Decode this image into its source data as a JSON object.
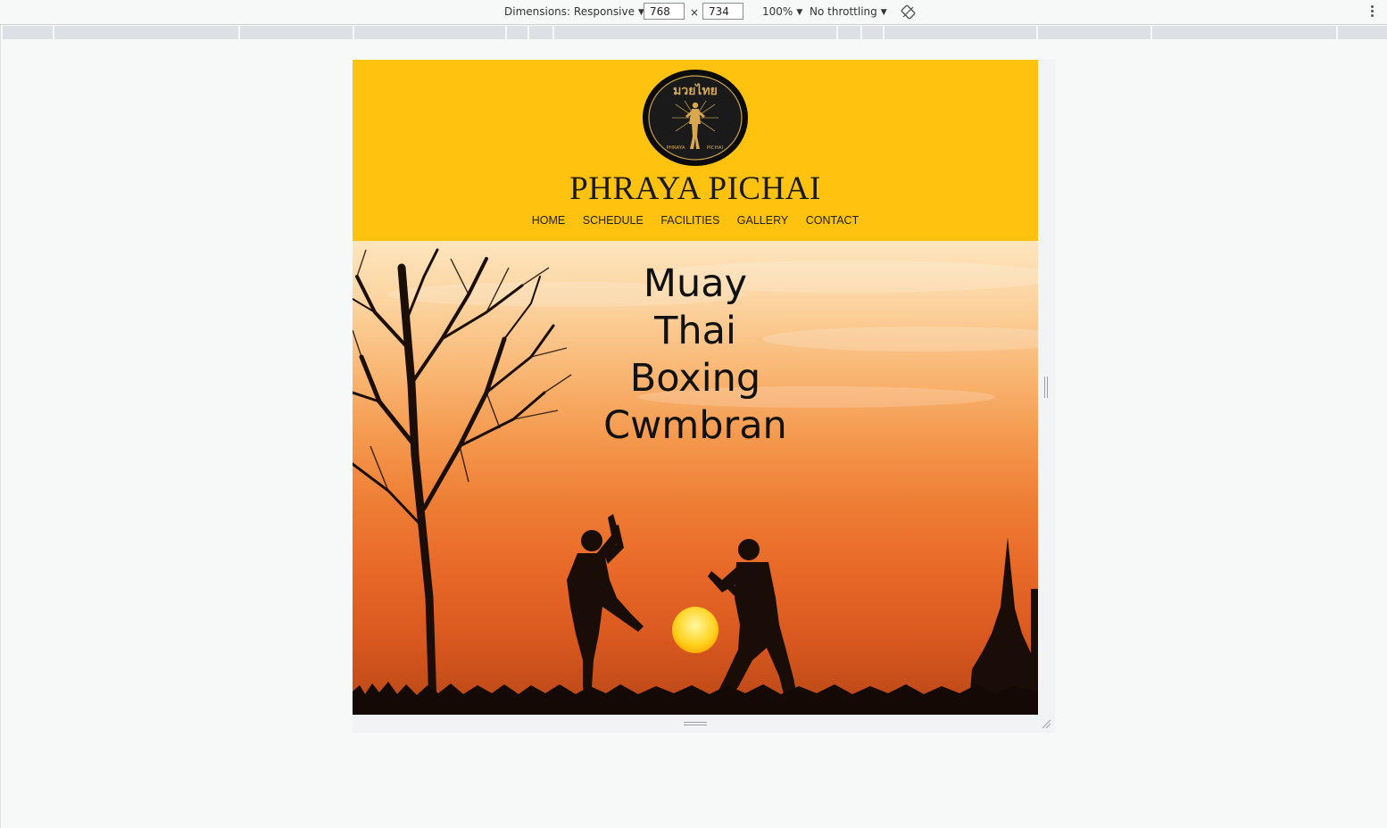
{
  "devtools": {
    "dimensions_label": "Dimensions: Responsive",
    "width_value": "768",
    "times_sign": "×",
    "height_value": "734",
    "zoom_label": "100%",
    "throttling_label": "No throttling",
    "caret": "▼"
  },
  "site": {
    "logo": {
      "thai_text": "มวยไทย",
      "left_text": "PHRAYA",
      "right_text": "PICHAI"
    },
    "title": "PHRAYA PICHAI",
    "nav": [
      "HOME",
      "SCHEDULE",
      "FACILITIES",
      "GALLERY",
      "CONTACT"
    ],
    "hero_lines": [
      "Muay",
      "Thai",
      "Boxing",
      "Cwmbran"
    ]
  },
  "colors": {
    "header_bg": "#ffc20e",
    "hero_text": "#111111"
  }
}
